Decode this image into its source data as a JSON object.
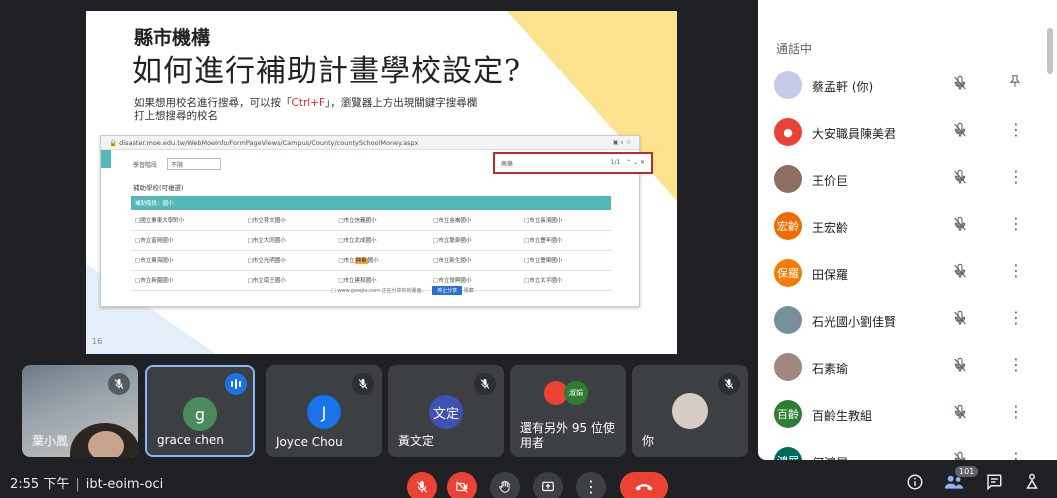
{
  "slide": {
    "org": "縣市機構",
    "title": "如何進行補助計畫學校設定?",
    "desc_line1_a": "如果想用校名進行搜尋，可以按「",
    "desc_line1_hl": "Ctrl+F",
    "desc_line1_b": "」，瀏覽器上方出現關鍵字搜尋欄",
    "desc_line2": "打上想搜尋的校名",
    "page_number": "16",
    "screenshot": {
      "url": "disaster.moe.edu.tw/WebMoeInfo/FormPageViews/Campus/County/countySchoolMoney.aspx",
      "filter_label": "學習階段",
      "filter_value": "不限",
      "find_text": "興華",
      "find_count": "1/1",
      "subtitle": "補助學校(可複選)",
      "table_header": "補助階段：國小",
      "rows": [
        [
          "□國立臺東大學附小",
          "□市立育文國小",
          "□市立信義國小",
          "□市立金崙國小",
          "□市立長濱國小"
        ],
        [
          "□市立富岡國小",
          "□市立大同國小",
          "□市立北成國小",
          "□市立龍泉國小",
          "□市立豐年國小"
        ],
        [
          "□市立東海國小",
          "□市立光明國小",
          "□市立興華國小",
          "□市立新生國小",
          "□市立豐榮國小"
        ],
        [
          "□市立新園國小",
          "□市立南王國小",
          "□市立建和國小",
          "□市立復興國小",
          "□市立太平國小"
        ]
      ],
      "highlight_word": "興華",
      "footer_text": "□ www.google.com 正在分享你的畫面。",
      "footer_stop": "停止分享",
      "footer_hide": "隱藏"
    }
  },
  "tiles": [
    {
      "name": "葉小鳳",
      "muted": true
    },
    {
      "name": "grace chen",
      "initial": "g",
      "color": "#4a8a5c",
      "speaking": true
    },
    {
      "name": "Joyce Chou",
      "initial": "J",
      "color": "#1a73e8",
      "muted": true
    },
    {
      "name": "黃文定",
      "initial": "文定",
      "color": "#3f51b5",
      "muted": true
    },
    {
      "name": "還有另外 95 位使用者",
      "muted": false,
      "mini_avatar": "淑娟"
    },
    {
      "name": "你",
      "muted": true
    }
  ],
  "panel": {
    "title": "通話中",
    "participants": [
      {
        "name": "蔡孟軒 (你)",
        "avatar": "",
        "color": "#c5cae9",
        "action": "pin-icon"
      },
      {
        "name": "大安職員陳美君",
        "avatar": "●",
        "color": "#ea4335",
        "action": "more"
      },
      {
        "name": "王价巨",
        "avatar": "",
        "color": "#8d6e63",
        "action": "more"
      },
      {
        "name": "王宏齡",
        "avatar": "宏齡",
        "color": "#ef6c00",
        "action": "more"
      },
      {
        "name": "田保羅",
        "avatar": "保羅",
        "color": "#f57c00",
        "action": "more"
      },
      {
        "name": "石光國小劉佳賢",
        "avatar": "",
        "color": "#78909c",
        "action": "more"
      },
      {
        "name": "石素瑜",
        "avatar": "",
        "color": "#a1887f",
        "action": "more"
      },
      {
        "name": "百齡生教組",
        "avatar": "百齡",
        "color": "#2e7d32",
        "action": "more"
      },
      {
        "name": "何鴻展",
        "avatar": "鴻展",
        "color": "#00695c",
        "action": "more"
      }
    ]
  },
  "bottom": {
    "time": "2:55 下午",
    "meeting_code": "ibt-eoim-oci",
    "participant_count": "101"
  }
}
